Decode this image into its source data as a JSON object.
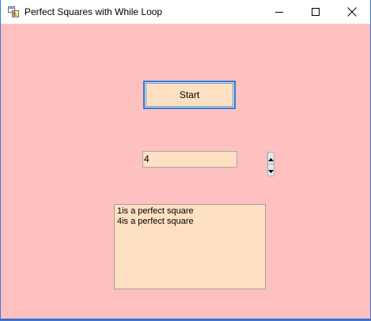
{
  "window": {
    "title": "Perfect Squares with While Loop",
    "icon": "winforms-app-icon",
    "controls": {
      "minimize_icon": "minimize-icon",
      "maximize_icon": "maximize-icon",
      "close_icon": "close-icon"
    }
  },
  "form": {
    "background_color": "#ffc0c0",
    "control_color": "#fde0c2",
    "start_button": {
      "label": "Start",
      "focus_color": "#2b7bd6"
    },
    "numeric_input": {
      "value": "4",
      "up_icon": "spin-up-icon",
      "down_icon": "spin-down-icon"
    },
    "output": {
      "lines": [
        "1is a perfect square",
        "4is a perfect square"
      ]
    }
  }
}
